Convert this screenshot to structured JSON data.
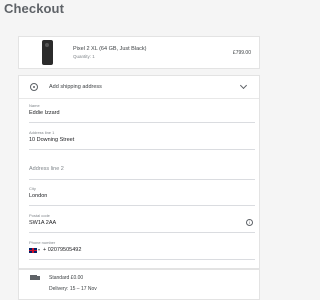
{
  "page": {
    "title": "Checkout"
  },
  "product": {
    "name": "Pixel 2 XL (64 GB, Just Black)",
    "quantity": "Quantity: 1",
    "price": "£799.00"
  },
  "address": {
    "title": "Add shipping address",
    "fields": [
      {
        "label": "Name",
        "value": "Eddie Izzard"
      },
      {
        "label": "Address line 1",
        "value": "10 Downing Street"
      },
      {
        "label": "",
        "value": "",
        "placeholder": "Address line 2"
      },
      {
        "label": "City",
        "value": "London"
      },
      {
        "label": "Postal code",
        "value": "SW1A 2AA"
      },
      {
        "label": "Phone number",
        "value": "+ 02079505492"
      }
    ]
  },
  "shipping": {
    "method": "Standard £0.00",
    "delivery": "Delivery: 15 – 17 Nov"
  },
  "colors": {
    "accent": "#5f6368",
    "card": "#ffffff",
    "background": "#f5f5f5"
  }
}
